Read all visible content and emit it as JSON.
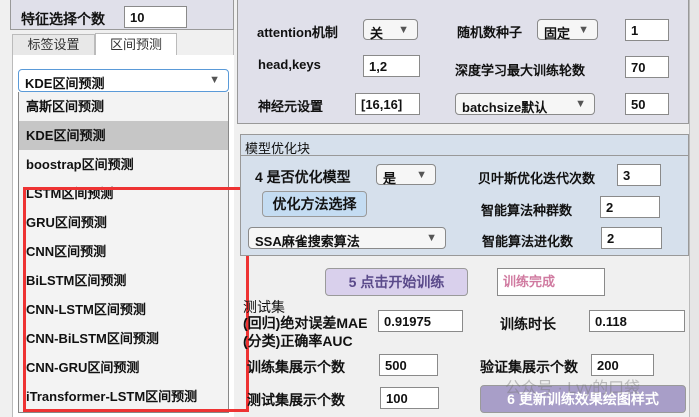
{
  "left": {
    "feature_count_label": "特征选择个数",
    "feature_count_value": "10",
    "tabs": [
      {
        "label": "标签设置"
      },
      {
        "label": "区间预测"
      }
    ],
    "interval_select": "KDE区间预测",
    "options": [
      "高斯区间预测",
      "KDE区间预测",
      "boostrap区间预测",
      "LSTM区间预测",
      "GRU区间预测",
      "CNN区间预测",
      "BiLSTM区间预测",
      "CNN-LSTM区间预测",
      "CNN-BiLSTM区间预测",
      "CNN-GRU区间预测",
      "iTransformer-LSTM区间预测"
    ],
    "highlighted_option": "KDE区间预测"
  },
  "params": {
    "attention_label": "attention机制",
    "attention_value": "关",
    "seed_label": "随机数种子",
    "seed_mode": "固定",
    "seed_value": "1",
    "headkeys_label": "head,keys",
    "headkeys_value": "1,2",
    "epochs_label": "深度学习最大训练轮数",
    "epochs_value": "70",
    "neurons_label": "神经元设置",
    "neurons_value": "[16,16]",
    "batch_mode": "batchsize默认",
    "batch_value": "50"
  },
  "opt": {
    "title": "模型优化块",
    "optimize_label": "4 是否优化模型",
    "optimize_value": "是",
    "bayes_label": "贝叶斯优化迭代次数",
    "bayes_value": "3",
    "method_button": "优化方法选择",
    "pop_label": "智能算法种群数",
    "pop_value": "2",
    "algo_value": "SSA麻雀搜索算法",
    "gen_label": "智能算法进化数",
    "gen_value": "2"
  },
  "train": {
    "start_button": "5 点击开始训练",
    "status": "训练完成",
    "test_label_1": "测试集",
    "test_label_2": "(回归)绝对误差MAE",
    "test_label_3": "(分类)正确率AUC",
    "mae_value": "0.91975",
    "time_label": "训练时长",
    "time_value": "0.118",
    "train_show_label": "训练集展示个数",
    "train_show_value": "500",
    "val_show_label": "验证集展示个数",
    "val_show_value": "200",
    "test_show_label": "测试集展示个数",
    "test_show_value": "100",
    "update_button": "6 更新训练效果绘图样式"
  },
  "watermark": "公众号 · Lvy的口袋",
  "colors": {
    "highlight_box": "#ee3333",
    "top_group": "#e0e0ea",
    "opt_group": "#d6e0ec"
  }
}
